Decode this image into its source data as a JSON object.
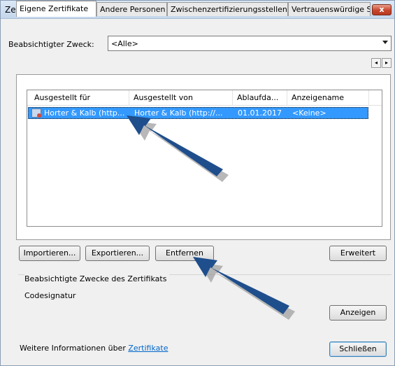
{
  "window": {
    "title": "Zertifikate",
    "close_label": "x"
  },
  "purpose": {
    "label": "Beabsichtigter Zweck:",
    "value": "<Alle>"
  },
  "tabs": [
    {
      "label": "Eigene Zertifikate",
      "active": true
    },
    {
      "label": "Andere Personen",
      "active": false
    },
    {
      "label": "Zwischenzertifizierungsstellen",
      "active": false
    },
    {
      "label": "Vertrauenswürdige S",
      "active": false
    }
  ],
  "tab_scroll": {
    "left": "◂",
    "right": "▸"
  },
  "list": {
    "columns": [
      "Ausgestellt für",
      "Ausgestellt von",
      "Ablaufda...",
      "Anzeigename"
    ],
    "rows": [
      {
        "issued_to": "Horter & Kalb (http...",
        "issued_by": "Horter & Kalb (http://...",
        "expires": "01.01.2017",
        "display_name": "<Keine>",
        "selected": true
      }
    ]
  },
  "buttons": {
    "import": "Importieren...",
    "export": "Exportieren...",
    "remove": "Entfernen",
    "advanced": "Erweitert",
    "view": "Anzeigen",
    "close": "Schließen"
  },
  "purposes_group": {
    "label": "Beabsichtigte Zwecke des Zertifikats",
    "value": "Codesignatur"
  },
  "footer": {
    "text": "Weitere Informationen über",
    "link": "Zertifikate"
  },
  "colors": {
    "selection": "#3399ff",
    "link": "#0066cc",
    "annotation_arrow": "#1f4e8c"
  }
}
